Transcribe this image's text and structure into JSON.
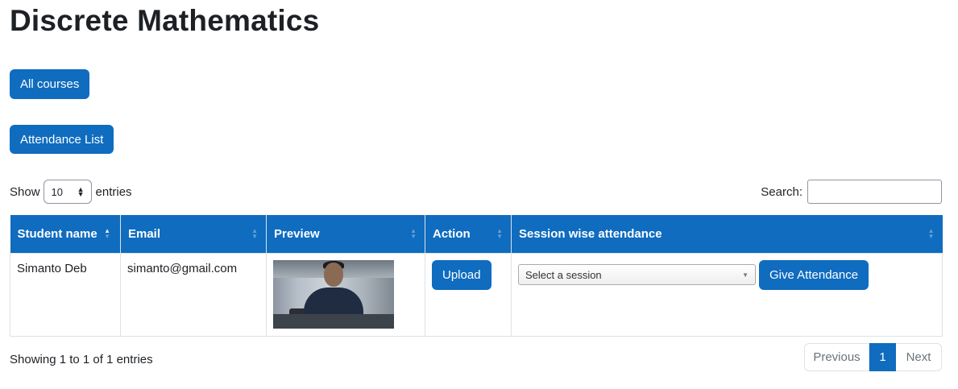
{
  "page": {
    "title": "Discrete Mathematics"
  },
  "buttons": {
    "all_courses": "All courses",
    "attendance_list": "Attendance List"
  },
  "table_controls": {
    "show_label": "Show",
    "entries_value": "10",
    "entries_label": "entries",
    "search_label": "Search:",
    "search_value": ""
  },
  "table": {
    "headers": [
      "Student name",
      "Email",
      "Preview",
      "Action",
      "Session wise attendance"
    ],
    "rows": [
      {
        "student_name": "Simanto Deb",
        "email": "simanto@gmail.com",
        "action_label": "Upload",
        "session_placeholder": "Select a session",
        "give_attendance_label": "Give Attendance"
      }
    ]
  },
  "footer": {
    "info": "Showing 1 to 1 of 1 entries",
    "pagination": {
      "previous": "Previous",
      "current": "1",
      "next": "Next"
    }
  },
  "colors": {
    "primary": "#0f6cbf",
    "text": "#1d2125",
    "border": "#dee2e6"
  },
  "icons": {
    "sort": "sort-icon",
    "sort_asc": "sort-asc-icon",
    "select_arrows": "updown-arrows-icon",
    "dropdown": "dropdown-arrow-icon"
  }
}
